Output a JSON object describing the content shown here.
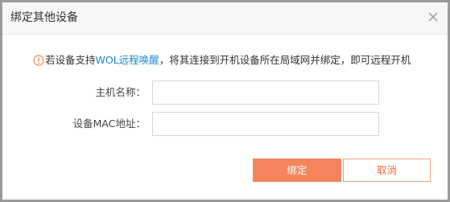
{
  "dialog": {
    "title": "绑定其他设备",
    "close_icon": "close-icon"
  },
  "notice": {
    "icon": "warning-circle-icon",
    "icon_color": "#f08a4b",
    "before_link": "若设备支持",
    "link_text": "WOL远程唤醒",
    "link_color": "#1f86d4",
    "after_link": "，将其连接到开机设备所在局域网并绑定，即可远程开机"
  },
  "form": {
    "host_label": "主机名称：",
    "host_value": "",
    "mac_label": "设备MAC地址：",
    "mac_value": ""
  },
  "buttons": {
    "bind_label": "绑定",
    "cancel_label": "取消",
    "primary_color": "#f4845c"
  }
}
